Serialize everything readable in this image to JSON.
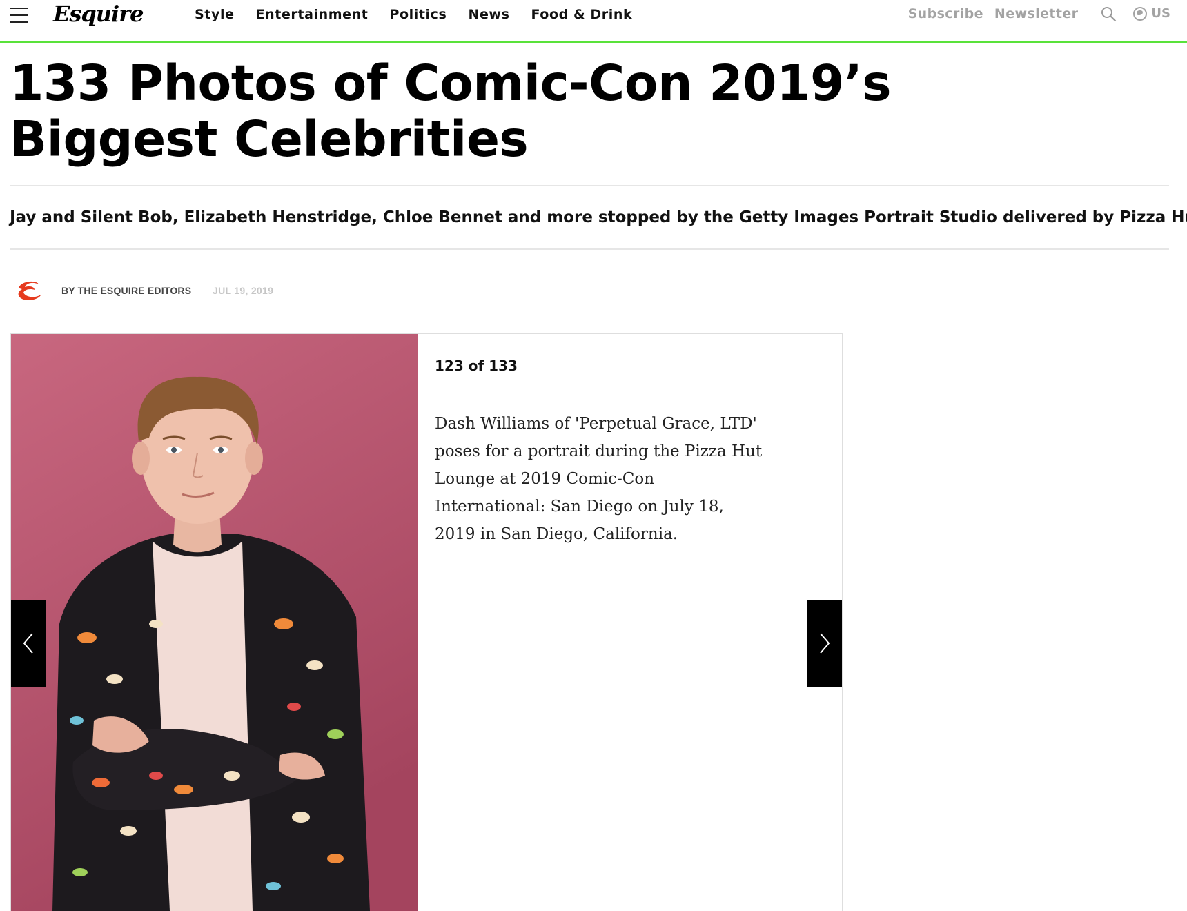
{
  "site": {
    "logo_text": "Esquire",
    "nav": [
      "Style",
      "Entertainment",
      "Politics",
      "News",
      "Food & Drink"
    ],
    "subscribe_label": "Subscribe",
    "newsletter_label": "Newsletter",
    "region_label": "US"
  },
  "article": {
    "headline": "133 Photos of Comic-Con 2019’s Biggest Celebrities",
    "dek": "Jay and Silent Bob, Elizabeth Henstridge, Chloe Bennet and more stopped by the Getty Images Portrait Studio delivered by Pizza Hut.",
    "byline": "BY THE ESQUIRE EDITORS",
    "date": "JUL 19, 2019"
  },
  "slideshow": {
    "counter": "123 of 133",
    "caption": "Dash Williams of 'Perpetual Grace, LTD' poses for a portrait during the Pizza Hut Lounge at 2019 Comic-Con International: San Diego on July 18, 2019 in San Diego, California.",
    "photo_background": "#b6526e"
  },
  "colors": {
    "accent_green": "#59e23a",
    "brand_red": "#e63a1e",
    "muted_gray": "#a3a3a3"
  },
  "icons": [
    "menu-icon",
    "search-icon",
    "globe-icon",
    "chevron-left-icon",
    "chevron-right-icon"
  ]
}
